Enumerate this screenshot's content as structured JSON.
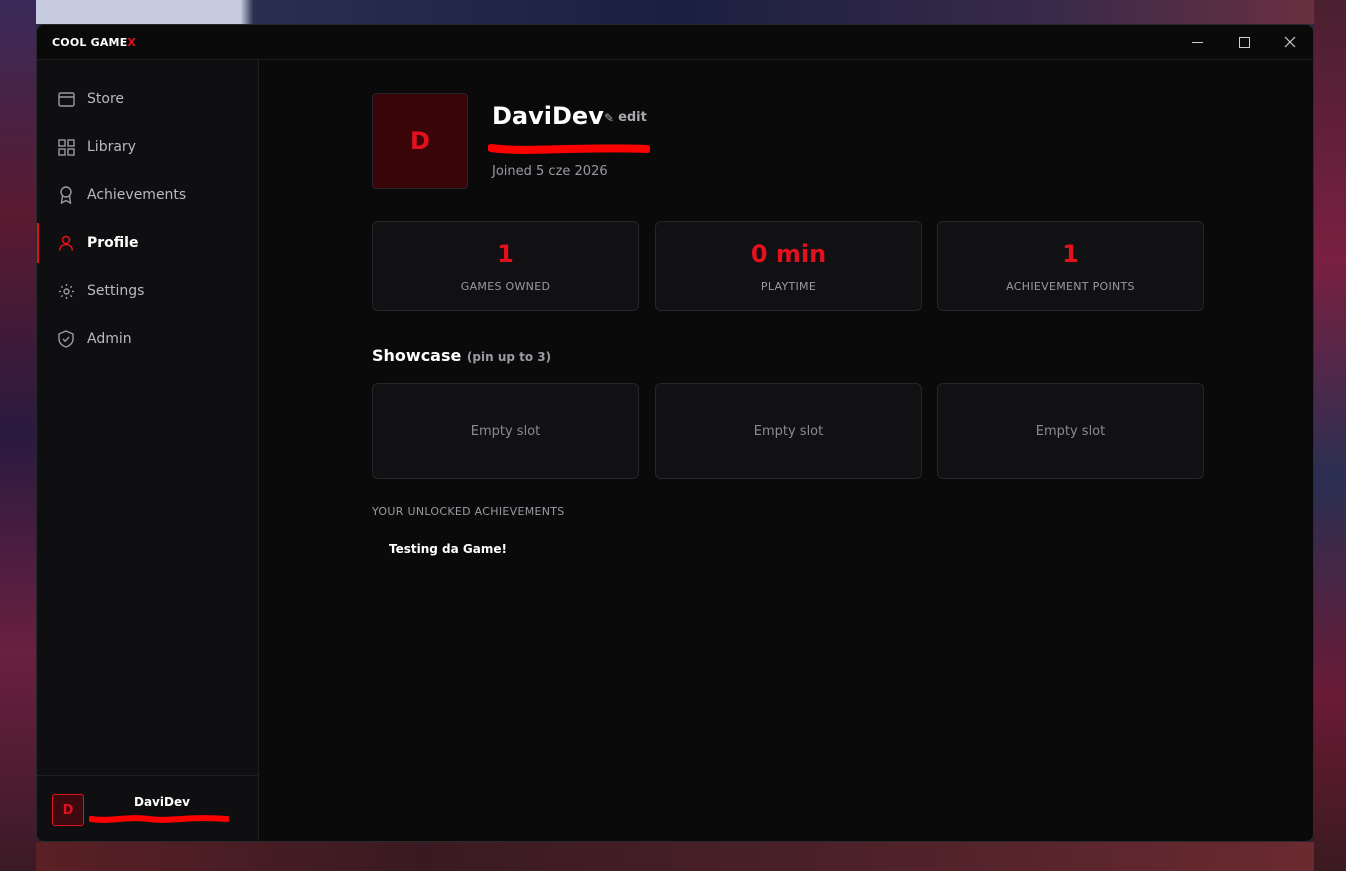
{
  "window": {
    "brand_main": "COOL GAME",
    "brand_accent": "X",
    "controls": [
      "minimize-icon",
      "maximize-icon",
      "close-icon"
    ]
  },
  "sidebar": {
    "items": [
      {
        "label": "Store",
        "icon": "store-icon"
      },
      {
        "label": "Library",
        "icon": "grid-icon"
      },
      {
        "label": "Achievements",
        "icon": "award-icon"
      },
      {
        "label": "Profile",
        "icon": "user-icon",
        "active": true
      },
      {
        "label": "Settings",
        "icon": "gear-icon"
      },
      {
        "label": "Admin",
        "icon": "shield-icon"
      }
    ],
    "user": {
      "initial": "D",
      "name": "DaviDev"
    }
  },
  "profile": {
    "initial": "D",
    "username": "DaviDev",
    "edit_label": "edit",
    "joined": "Joined 5 cze 2026"
  },
  "stats": [
    {
      "value": "1",
      "label": "GAMES OWNED"
    },
    {
      "value": "0 min",
      "label": "PLAYTIME"
    },
    {
      "value": "1",
      "label": "ACHIEVEMENT POINTS"
    }
  ],
  "showcase": {
    "title": "Showcase",
    "hint": "(pin up to 3)",
    "slots": [
      "Empty slot",
      "Empty slot",
      "Empty slot"
    ]
  },
  "achievements": {
    "header": "YOUR UNLOCKED ACHIEVEMENTS",
    "items": [
      "Testing da Game!"
    ]
  },
  "colors": {
    "accent": "#e3101e",
    "background": "#0a0a0b",
    "sidebar": "#0f0f11",
    "card": "#111113"
  }
}
